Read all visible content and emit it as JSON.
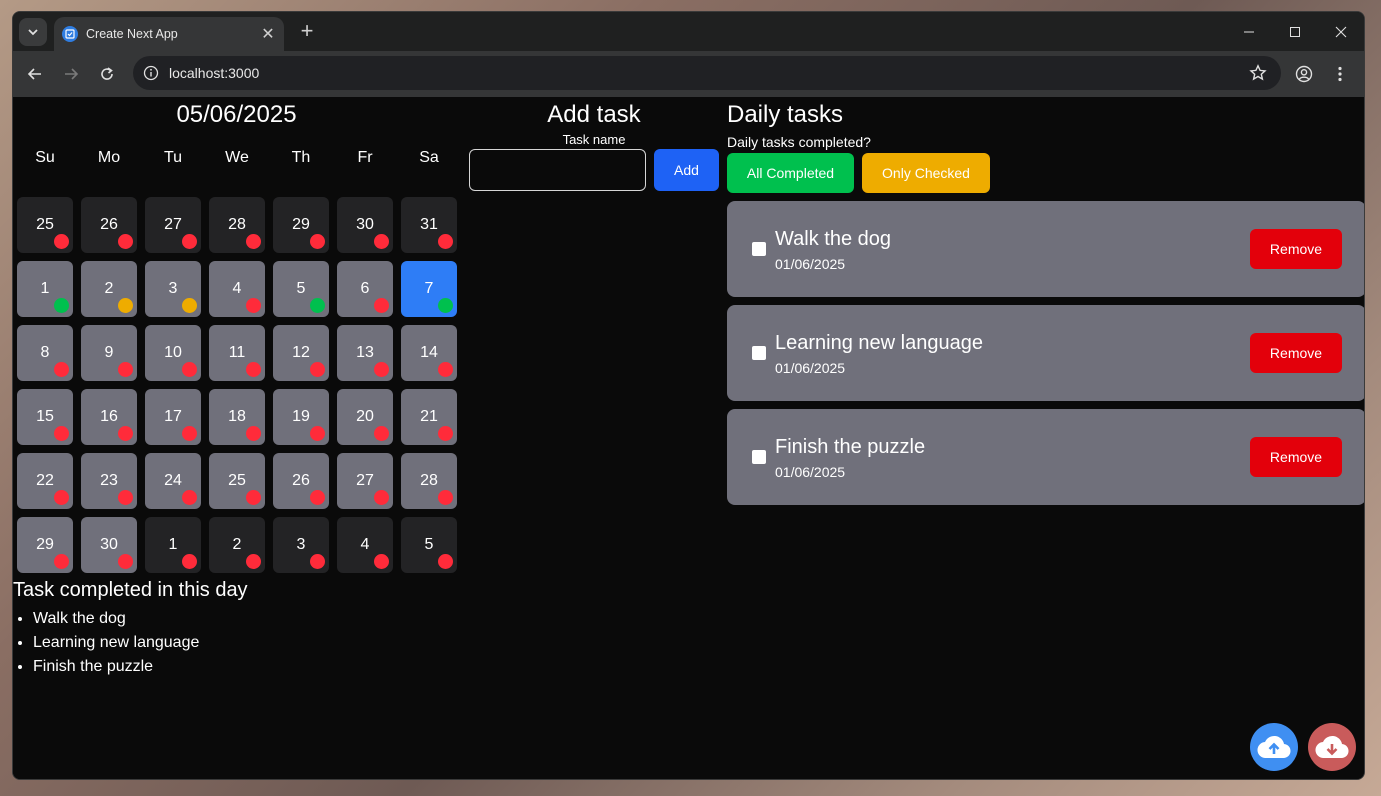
{
  "browser": {
    "tab_title": "Create Next App",
    "url": "localhost:3000"
  },
  "calendar": {
    "date_title": "05/06/2025",
    "weekdays": [
      "Su",
      "Mo",
      "Tu",
      "We",
      "Th",
      "Fr",
      "Sa"
    ],
    "days": [
      {
        "n": "25",
        "state": "other",
        "status": "red"
      },
      {
        "n": "26",
        "state": "other",
        "status": "red"
      },
      {
        "n": "27",
        "state": "other",
        "status": "red"
      },
      {
        "n": "28",
        "state": "other",
        "status": "red"
      },
      {
        "n": "29",
        "state": "other",
        "status": "red"
      },
      {
        "n": "30",
        "state": "other",
        "status": "red"
      },
      {
        "n": "31",
        "state": "other",
        "status": "red"
      },
      {
        "n": "1",
        "state": "cur",
        "status": "green"
      },
      {
        "n": "2",
        "state": "cur",
        "status": "yellow"
      },
      {
        "n": "3",
        "state": "cur",
        "status": "yellow"
      },
      {
        "n": "4",
        "state": "cur",
        "status": "red"
      },
      {
        "n": "5",
        "state": "cur",
        "status": "green"
      },
      {
        "n": "6",
        "state": "cur",
        "status": "red"
      },
      {
        "n": "7",
        "state": "sel",
        "status": "green"
      },
      {
        "n": "8",
        "state": "cur",
        "status": "red"
      },
      {
        "n": "9",
        "state": "cur",
        "status": "red"
      },
      {
        "n": "10",
        "state": "cur",
        "status": "red"
      },
      {
        "n": "11",
        "state": "cur",
        "status": "red"
      },
      {
        "n": "12",
        "state": "cur",
        "status": "red"
      },
      {
        "n": "13",
        "state": "cur",
        "status": "red"
      },
      {
        "n": "14",
        "state": "cur",
        "status": "red"
      },
      {
        "n": "15",
        "state": "cur",
        "status": "red"
      },
      {
        "n": "16",
        "state": "cur",
        "status": "red"
      },
      {
        "n": "17",
        "state": "cur",
        "status": "red"
      },
      {
        "n": "18",
        "state": "cur",
        "status": "red"
      },
      {
        "n": "19",
        "state": "cur",
        "status": "red"
      },
      {
        "n": "20",
        "state": "cur",
        "status": "red"
      },
      {
        "n": "21",
        "state": "cur",
        "status": "red"
      },
      {
        "n": "22",
        "state": "cur",
        "status": "red"
      },
      {
        "n": "23",
        "state": "cur",
        "status": "red"
      },
      {
        "n": "24",
        "state": "cur",
        "status": "red"
      },
      {
        "n": "25",
        "state": "cur",
        "status": "red"
      },
      {
        "n": "26",
        "state": "cur",
        "status": "red"
      },
      {
        "n": "27",
        "state": "cur",
        "status": "red"
      },
      {
        "n": "28",
        "state": "cur",
        "status": "red"
      },
      {
        "n": "29",
        "state": "cur",
        "status": "red"
      },
      {
        "n": "30",
        "state": "cur",
        "status": "red"
      },
      {
        "n": "1",
        "state": "other",
        "status": "red"
      },
      {
        "n": "2",
        "state": "other",
        "status": "red"
      },
      {
        "n": "3",
        "state": "other",
        "status": "red"
      },
      {
        "n": "4",
        "state": "other",
        "status": "red"
      },
      {
        "n": "5",
        "state": "other",
        "status": "red"
      }
    ],
    "status_colors": {
      "red": "#ff2b3a",
      "green": "#00c04e",
      "yellow": "#eeac00"
    }
  },
  "completed": {
    "title": "Task completed in this day",
    "items": [
      "Walk the dog",
      "Learning new language",
      "Finish the puzzle"
    ]
  },
  "add_task": {
    "title": "Add task",
    "label": "Task name",
    "input_value": "",
    "button": "Add"
  },
  "daily": {
    "title": "Daily tasks",
    "question": "Daily tasks completed?",
    "all_completed_btn": "All Completed",
    "only_checked_btn": "Only Checked",
    "tasks": [
      {
        "name": "Walk the dog",
        "date": "01/06/2025",
        "remove": "Remove"
      },
      {
        "name": "Learning new language",
        "date": "01/06/2025",
        "remove": "Remove"
      },
      {
        "name": "Finish the puzzle",
        "date": "01/06/2025",
        "remove": "Remove"
      }
    ]
  },
  "fabs": {
    "upload_icon": "cloud-upload-icon",
    "download_icon": "cloud-download-icon"
  }
}
